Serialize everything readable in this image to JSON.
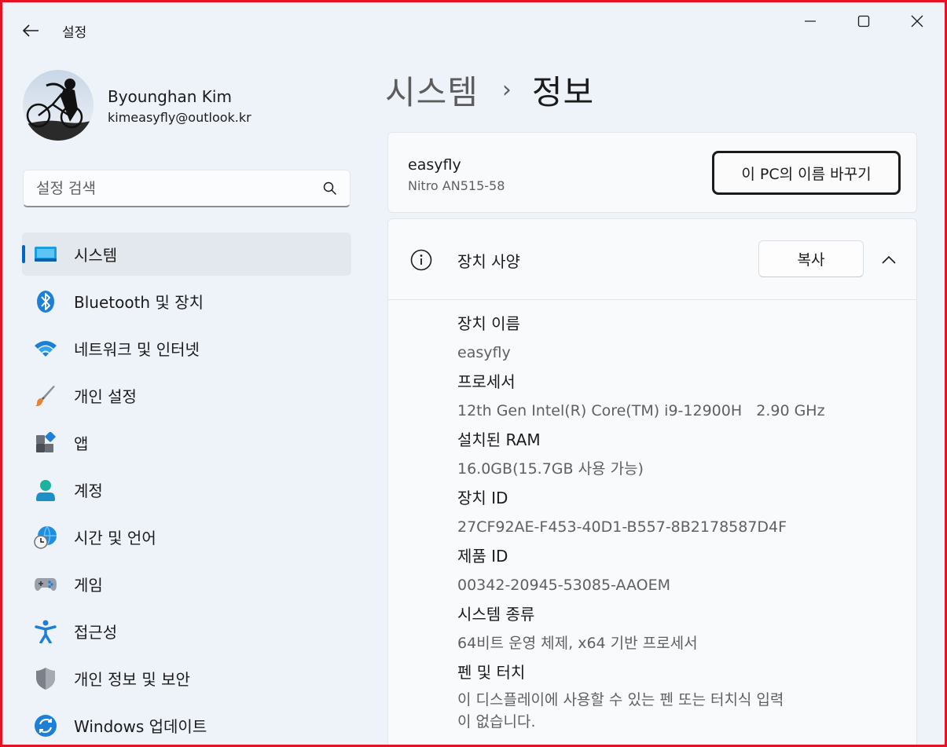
{
  "window": {
    "title": "설정"
  },
  "profile": {
    "name": "Byounghan Kim",
    "email": "kimeasyfly@outlook.kr"
  },
  "search": {
    "placeholder": "설정 검색"
  },
  "sidebar": {
    "items": [
      {
        "label": "시스템",
        "icon": "system-monitor-icon",
        "active": true
      },
      {
        "label": "Bluetooth 및 장치",
        "icon": "bluetooth-icon"
      },
      {
        "label": "네트워크 및 인터넷",
        "icon": "wifi-icon"
      },
      {
        "label": "개인 설정",
        "icon": "paintbrush-icon"
      },
      {
        "label": "앱",
        "icon": "apps-icon"
      },
      {
        "label": "계정",
        "icon": "person-icon"
      },
      {
        "label": "시간 및 언어",
        "icon": "globe-clock-icon"
      },
      {
        "label": "게임",
        "icon": "gamepad-icon"
      },
      {
        "label": "접근성",
        "icon": "accessibility-icon"
      },
      {
        "label": "개인 정보 및 보안",
        "icon": "shield-icon"
      },
      {
        "label": "Windows 업데이트",
        "icon": "update-icon"
      }
    ]
  },
  "breadcrumb": {
    "parent": "시스템",
    "separator": "›",
    "current": "정보"
  },
  "device": {
    "name": "easyfly",
    "model": "Nitro AN515-58",
    "rename_label": "이 PC의 이름 바꾸기"
  },
  "specs": {
    "title": "장치 사양",
    "copy_label": "복사",
    "items": [
      {
        "label": "장치 이름",
        "value": "easyfly"
      },
      {
        "label": "프로세서",
        "value": "12th Gen Intel(R) Core(TM) i9-12900H   2.90 GHz"
      },
      {
        "label": "설치된 RAM",
        "value": "16.0GB(15.7GB 사용 가능)"
      },
      {
        "label": "장치 ID",
        "value": "27CF92AE-F453-40D1-B557-8B2178587D4F"
      },
      {
        "label": "제품 ID",
        "value": "00342-20945-53085-AAOEM"
      },
      {
        "label": "시스템 종류",
        "value": "64비트 운영 체제, x64 기반 프로세서"
      },
      {
        "label": "펜 및 터치",
        "value": "이 디스플레이에 사용할 수 있는 펜 또는 터치식 입력\n이 없습니다."
      }
    ]
  },
  "colors": {
    "accent": "#0067c0",
    "background": "#eef3f9",
    "frame": "#e81123"
  }
}
